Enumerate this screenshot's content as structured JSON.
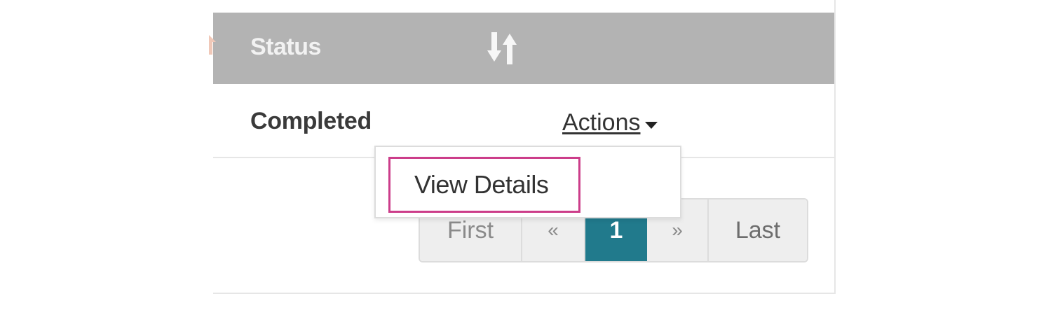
{
  "table": {
    "header": {
      "status_label": "Status"
    },
    "row": {
      "status_value": "Completed",
      "actions_label": "Actions"
    }
  },
  "dropdown": {
    "items": [
      {
        "label": "View Details",
        "highlighted": true
      }
    ]
  },
  "pagination": {
    "first_label": "First",
    "prev_label": "«",
    "current_page": "1",
    "next_label": "»",
    "last_label": "Last"
  },
  "colors": {
    "header_bg": "#b3b3b3",
    "active_page": "#217a8c",
    "highlight_border": "#cc3d8a"
  }
}
